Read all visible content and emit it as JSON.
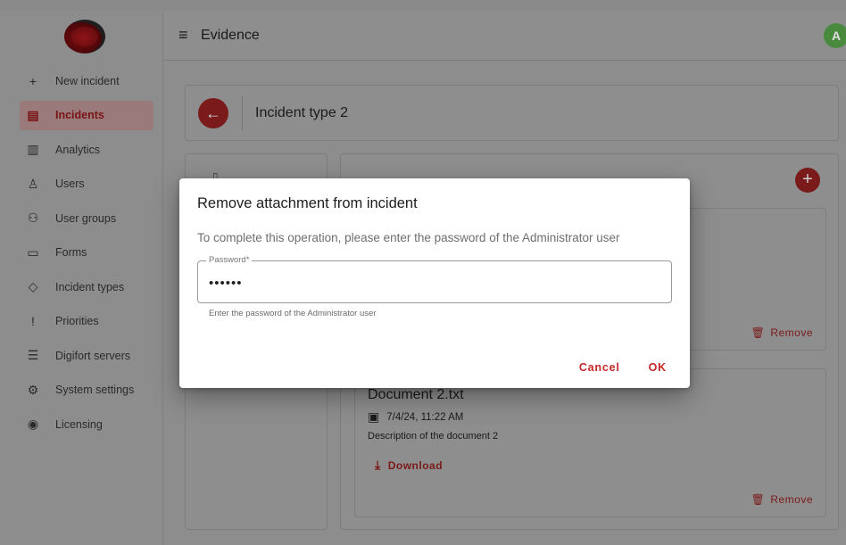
{
  "header": {
    "title": "Evidence",
    "avatar_letter": "A"
  },
  "sidebar": {
    "items": [
      {
        "label": "New incident",
        "icon": "plus-icon",
        "glyph": "+"
      },
      {
        "label": "Incidents",
        "icon": "inbox-icon",
        "glyph": "▤"
      },
      {
        "label": "Analytics",
        "icon": "analytics-icon",
        "glyph": "▥"
      },
      {
        "label": "Users",
        "icon": "user-icon",
        "glyph": "♙"
      },
      {
        "label": "User groups",
        "icon": "user-group-icon",
        "glyph": "⚇"
      },
      {
        "label": "Forms",
        "icon": "form-icon",
        "glyph": "▭"
      },
      {
        "label": "Incident types",
        "icon": "diamond-alert-icon",
        "glyph": "◇"
      },
      {
        "label": "Priorities",
        "icon": "exclamation-icon",
        "glyph": "!"
      },
      {
        "label": "Digifort servers",
        "icon": "server-icon",
        "glyph": "☰"
      },
      {
        "label": "System settings",
        "icon": "gear-icon",
        "glyph": "⚙"
      },
      {
        "label": "Licensing",
        "icon": "license-icon",
        "glyph": "◉"
      }
    ],
    "active_index": 1
  },
  "incident": {
    "title": "Incident type 2",
    "back_glyph": "←"
  },
  "attachments": {
    "add_glyph": "+",
    "remove_label": "Remove",
    "download_label": "Download",
    "documents": [
      {
        "name": "Document 2.txt",
        "date": "7/4/24, 11:22 AM",
        "description": "Description of the document 2"
      }
    ]
  },
  "dialog": {
    "title": "Remove attachment from incident",
    "message": "To complete this operation, please enter the password of the Administrator user",
    "password_label": "Password*",
    "password_value": "••••••",
    "helper": "Enter the password of the Administrator user",
    "cancel_label": "Cancel",
    "ok_label": "OK"
  },
  "colors": {
    "accent": "#c62828",
    "backdrop": "#8d8d8d",
    "dialog_bg": "#ffffff"
  }
}
